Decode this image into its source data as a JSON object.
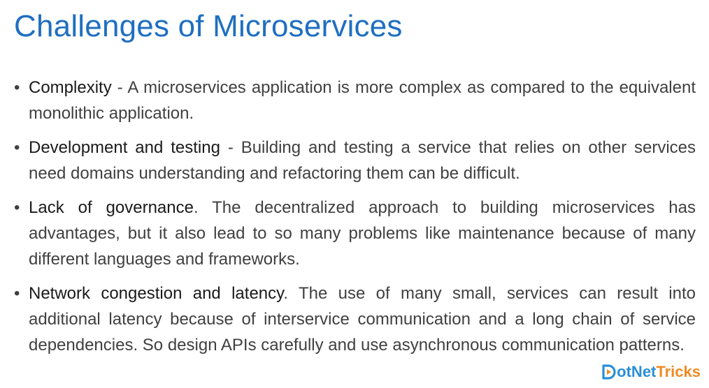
{
  "slide": {
    "title": "Challenges of Microservices",
    "bullet_symbol": "•",
    "bullets": [
      {
        "term": "Complexity",
        "separator": " - ",
        "text": "A microservices application is more complex as compared to the equivalent monolithic application."
      },
      {
        "term": "Development and testing",
        "separator": " - ",
        "text": "Building and testing a service that relies on other services need domains understanding and refactoring them can be difficult."
      },
      {
        "term": "Lack of governance",
        "separator": ". ",
        "text": "The decentralized approach to building microservices has advantages, but it also lead to so many problems like maintenance because of many different languages and frameworks."
      },
      {
        "term": "Network congestion and latency",
        "separator": ". ",
        "text": "The use of many small, services can result into additional latency because of interservice communication and a long chain of service dependencies. So design APIs carefully and use asynchronous communication patterns."
      }
    ]
  },
  "logo": {
    "icon": "play-d-icon",
    "part_a": "otNet",
    "part_b": "Tricks",
    "colors": {
      "blue": "#2a8fd6",
      "orange": "#f08a24"
    }
  },
  "colors": {
    "title": "#1f6fc0",
    "body_text": "#404040",
    "term_text": "#1a1a1a"
  }
}
